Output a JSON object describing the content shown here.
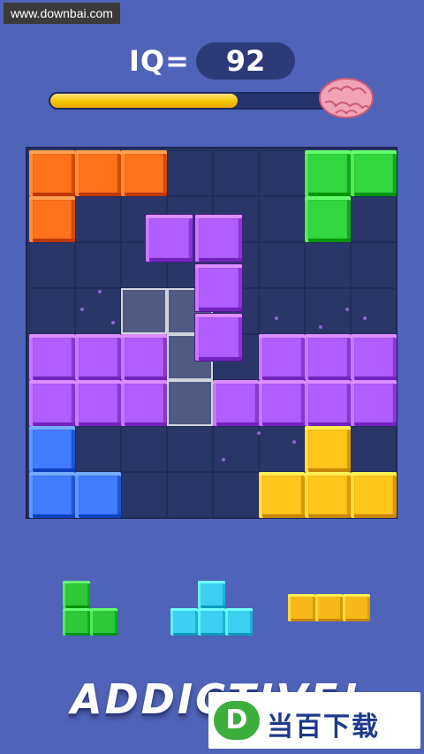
{
  "watermark": "www.downbai.com",
  "header": {
    "iq_label": "IQ=",
    "iq_value": "92",
    "progress_fraction": 0.67,
    "brain_icon": "brain-icon"
  },
  "board": {
    "rows": 8,
    "cols": 8,
    "colors": {
      "orange": "#f06a1a",
      "green": "#2ec73a",
      "purple": "#a556f0",
      "blue": "#3d73f0",
      "yellow": "#f7b81a",
      "cyan": "#3ccff0"
    },
    "placed_blocks": [
      {
        "row": 0,
        "col": 0,
        "color": "orange"
      },
      {
        "row": 0,
        "col": 1,
        "color": "orange"
      },
      {
        "row": 0,
        "col": 2,
        "color": "orange"
      },
      {
        "row": 1,
        "col": 0,
        "color": "orange"
      },
      {
        "row": 0,
        "col": 6,
        "color": "green"
      },
      {
        "row": 0,
        "col": 7,
        "color": "green"
      },
      {
        "row": 1,
        "col": 6,
        "color": "green"
      },
      {
        "row": 4,
        "col": 0,
        "color": "purple"
      },
      {
        "row": 4,
        "col": 1,
        "color": "purple"
      },
      {
        "row": 4,
        "col": 2,
        "color": "purple"
      },
      {
        "row": 4,
        "col": 5,
        "color": "purple"
      },
      {
        "row": 4,
        "col": 6,
        "color": "purple"
      },
      {
        "row": 4,
        "col": 7,
        "color": "purple"
      },
      {
        "row": 5,
        "col": 0,
        "color": "purple"
      },
      {
        "row": 5,
        "col": 1,
        "color": "purple"
      },
      {
        "row": 5,
        "col": 2,
        "color": "purple"
      },
      {
        "row": 5,
        "col": 4,
        "color": "purple"
      },
      {
        "row": 5,
        "col": 5,
        "color": "purple"
      },
      {
        "row": 5,
        "col": 6,
        "color": "purple"
      },
      {
        "row": 5,
        "col": 7,
        "color": "purple"
      },
      {
        "row": 6,
        "col": 0,
        "color": "blue"
      },
      {
        "row": 7,
        "col": 0,
        "color": "blue"
      },
      {
        "row": 7,
        "col": 1,
        "color": "blue"
      },
      {
        "row": 6,
        "col": 6,
        "color": "yellow"
      },
      {
        "row": 7,
        "col": 5,
        "color": "yellow"
      },
      {
        "row": 7,
        "col": 6,
        "color": "yellow"
      },
      {
        "row": 7,
        "col": 7,
        "color": "yellow"
      }
    ],
    "ghost_cells": [
      {
        "row": 3,
        "col": 2
      },
      {
        "row": 3,
        "col": 3
      },
      {
        "row": 4,
        "col": 3
      },
      {
        "row": 5,
        "col": 3
      }
    ],
    "dragging_piece": {
      "color": "purple",
      "cells": [
        {
          "row": 0,
          "col": 0
        },
        {
          "row": 0,
          "col": 1
        },
        {
          "row": 1,
          "col": 1
        },
        {
          "row": 2,
          "col": 1
        }
      ]
    }
  },
  "tray": [
    {
      "name": "tray-piece-green-l",
      "color": "green",
      "cells": [
        {
          "r": 0,
          "c": 0
        },
        {
          "r": 1,
          "c": 0
        },
        {
          "r": 1,
          "c": 1
        }
      ]
    },
    {
      "name": "tray-piece-cyan-t",
      "color": "cyan",
      "cells": [
        {
          "r": 0,
          "c": 1
        },
        {
          "r": 1,
          "c": 0
        },
        {
          "r": 1,
          "c": 1
        },
        {
          "r": 1,
          "c": 2
        }
      ]
    },
    {
      "name": "tray-piece-yellow-i3",
      "color": "yellow",
      "cells": [
        {
          "r": 0,
          "c": 0
        },
        {
          "r": 0,
          "c": 1
        },
        {
          "r": 0,
          "c": 2
        }
      ]
    }
  ],
  "slogan": "ADDICTIVE!",
  "badge": {
    "logo_letter": "D",
    "text": "当百下载"
  }
}
